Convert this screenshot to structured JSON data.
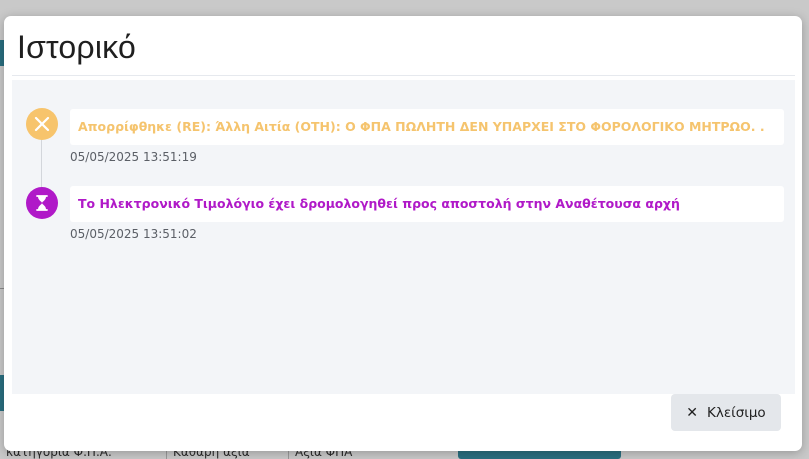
{
  "modal": {
    "title": "Ιστορικό",
    "close_label": "Κλείσιμο",
    "close_icon": "close-icon"
  },
  "timeline": [
    {
      "status": "rejected",
      "icon": "x-icon",
      "color": "#f7c46c",
      "message": "Απορρίφθηκε (RE): Άλλη Αιτία (OTH): Ο ΦΠΑ ΠΩΛΗΤΗ ΔΕΝ ΥΠΑΡΧΕΙ ΣΤΟ ΦΟΡΟΛΟΓΙΚΟ ΜΗΤΡΩΟ. .",
      "timestamp": "05/05/2025 13:51:19"
    },
    {
      "status": "pending",
      "icon": "hourglass-icon",
      "color": "#b019c8",
      "message": "Το Ηλεκτρονικό Τιμολόγιο έχει δρομολογηθεί προς αποστολή στην Αναθέτουσα αρχή",
      "timestamp": "05/05/2025 13:51:02"
    }
  ],
  "background": {
    "bottom_cells": [
      "κατηγορία Φ.Π.Α.",
      "Καθαρή αξία",
      "Αξία ΦΠΑ"
    ]
  }
}
